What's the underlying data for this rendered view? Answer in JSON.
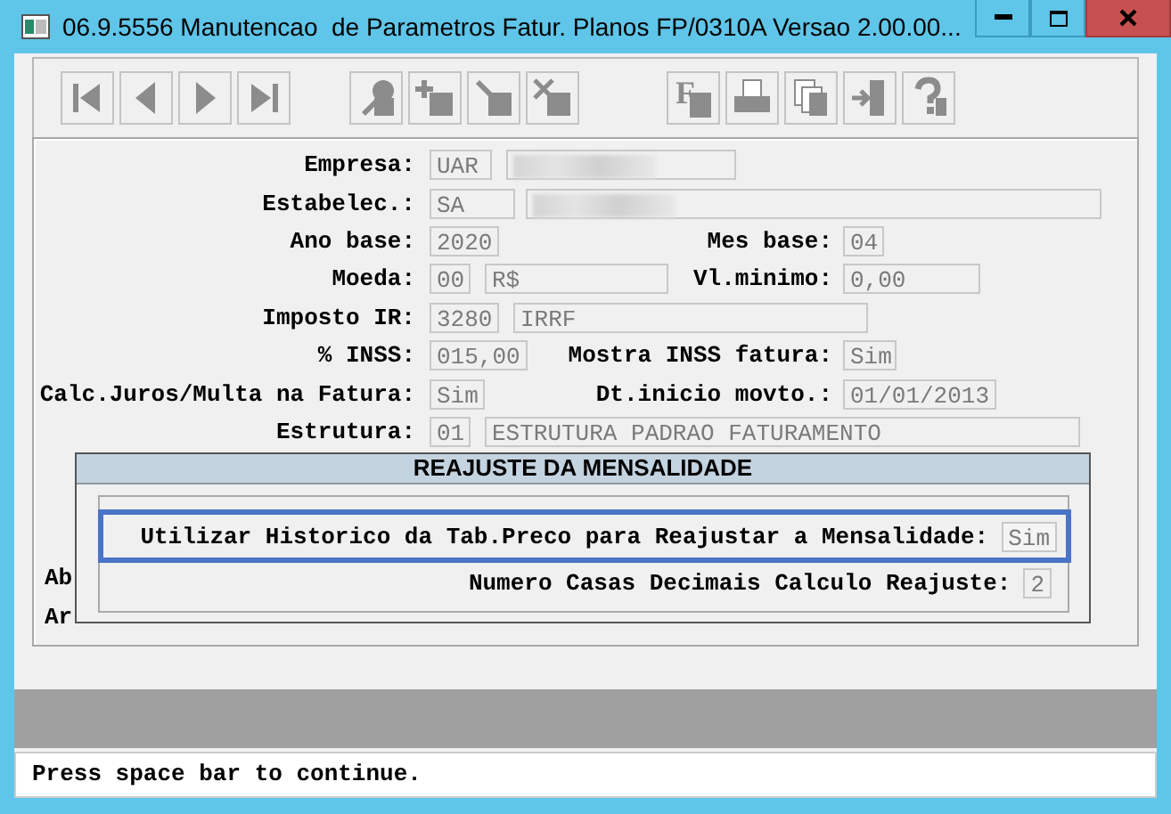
{
  "window": {
    "title": "06.9.5556 Manutencao  de Parametros Fatur. Planos FP/0310A Versao 2.00.00..."
  },
  "toolbar": [
    {
      "buttons": [
        {
          "kind": "first"
        },
        {
          "kind": "prev"
        },
        {
          "kind": "next"
        },
        {
          "kind": "last"
        }
      ]
    },
    {
      "buttons": [
        {
          "kind": "search"
        },
        {
          "kind": "add"
        },
        {
          "kind": "edit"
        },
        {
          "kind": "delete"
        }
      ]
    },
    {
      "buttons": [
        {
          "kind": "filter",
          "label": "F"
        },
        {
          "kind": "print"
        },
        {
          "kind": "copy"
        },
        {
          "kind": "exit"
        },
        {
          "kind": "help"
        }
      ]
    }
  ],
  "form": {
    "rows": [
      {
        "label": "Empresa:",
        "fields": [
          {
            "value": "UAR"
          },
          {
            "kind": "blurred"
          }
        ]
      },
      {
        "label": "Estabelec.:",
        "fields": [
          {
            "value": "SA"
          },
          {
            "kind": "blurred"
          }
        ]
      },
      {
        "label": "Ano base:",
        "fields": [
          {
            "value": "2020"
          }
        ],
        "label2": "Mes base:",
        "fields2": [
          {
            "value": "04"
          }
        ]
      },
      {
        "label": "Moeda:",
        "fields": [
          {
            "value": "00"
          },
          {
            "value": "R$"
          }
        ],
        "label2": "Vl.minimo:",
        "fields2": [
          {
            "value": "0,00"
          }
        ]
      },
      {
        "label": "Imposto IR:",
        "fields": [
          {
            "value": "3280"
          },
          {
            "value": "IRRF"
          }
        ]
      },
      {
        "label": "% INSS:",
        "fields": [
          {
            "value": "015,00"
          }
        ],
        "label2": "Mostra INSS fatura:",
        "fields2": [
          {
            "value": "Sim"
          }
        ]
      },
      {
        "label": "Calc.Juros/Multa na Fatura:",
        "fields": [
          {
            "value": "Sim"
          }
        ],
        "label2": "Dt.inicio movto.:",
        "fields2": [
          {
            "value": "01/01/2013"
          }
        ]
      },
      {
        "label": "Estrutura:",
        "fields": [
          {
            "value": "01"
          },
          {
            "value": "ESTRUTURA PADRAO FATURAMENTO"
          }
        ]
      }
    ],
    "covered_rows": [
      {
        "label": "Ab"
      },
      {
        "label": "Ar"
      }
    ]
  },
  "dialog": {
    "title": "REAJUSTE DA MENSALIDADE",
    "rows": [
      {
        "label": "Utilizar Historico da Tab.Preco para Reajustar a Mensalidade:",
        "value": "Sim",
        "focused": true
      },
      {
        "label": "Numero Casas Decimais Calculo Reajuste:",
        "value": "2",
        "focused": false
      }
    ]
  },
  "status_bar": "Press space bar to continue."
}
